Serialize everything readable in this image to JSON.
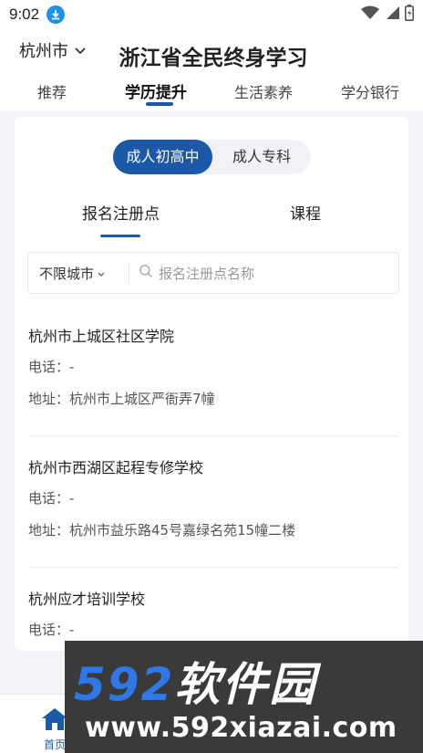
{
  "status_bar": {
    "time": "9:02"
  },
  "header": {
    "city": "杭州市",
    "title": "浙江省全民终身学习",
    "tabs": [
      {
        "label": "推荐"
      },
      {
        "label": "学历提升",
        "active": true
      },
      {
        "label": "生活素养"
      },
      {
        "label": "学分银行"
      }
    ]
  },
  "segment": {
    "options": [
      "成人初高中",
      "成人专科"
    ],
    "selected": "成人初高中"
  },
  "sub_tabs": [
    {
      "label": "报名注册点",
      "active": true
    },
    {
      "label": "课程"
    }
  ],
  "filter": {
    "city": "不限城市",
    "search_placeholder": "报名注册点名称"
  },
  "entries": [
    {
      "name": "杭州市上城区社区学院",
      "phone": "电话：-",
      "address": "地址：杭州市上城区严衙弄7幢"
    },
    {
      "name": "杭州市西湖区起程专修学校",
      "phone": "电话：-",
      "address": "地址：杭州市益乐路45号嘉绿名苑15幢二楼"
    },
    {
      "name": "杭州应才培训学校",
      "phone": "电话：-"
    }
  ],
  "bottom_nav": {
    "home_label": "首页"
  },
  "watermark": {
    "brand_num": "592",
    "brand_cn": "软件园",
    "url": "www.592xiazai.com"
  },
  "colors": {
    "accent": "#1c58a8",
    "background": "#f2f4f7"
  }
}
